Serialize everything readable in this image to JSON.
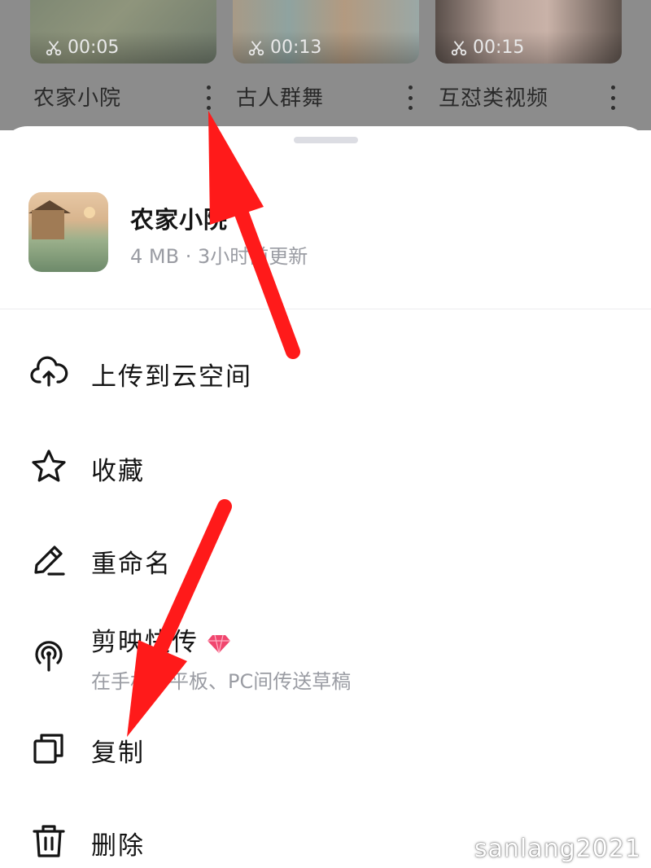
{
  "video_grid": [
    {
      "title": "农家小院",
      "duration": "00:05"
    },
    {
      "title": "古人群舞",
      "duration": "00:13"
    },
    {
      "title": "互怼类视频",
      "duration": "00:15"
    }
  ],
  "sheet": {
    "file": {
      "name": "农家小院",
      "meta": "4 MB · 3小时前更新"
    },
    "menu": [
      {
        "label": "上传到云空间",
        "icon": "cloud-upload-icon"
      },
      {
        "label": "收藏",
        "icon": "star-icon"
      },
      {
        "label": "重命名",
        "icon": "pencil-icon"
      },
      {
        "label": "剪映快传",
        "sublabel": "在手机、平板、PC间传送草稿",
        "icon": "broadcast-icon",
        "badge": "vip-diamond-icon"
      },
      {
        "label": "复制",
        "icon": "copy-icon"
      },
      {
        "label": "删除",
        "icon": "trash-icon"
      }
    ]
  },
  "watermark": "sanlang2021",
  "colors": {
    "annotation_arrow": "#ff1a1a",
    "dim_overlay": "#8c8c8c",
    "vip_badge": "#f0466e"
  }
}
